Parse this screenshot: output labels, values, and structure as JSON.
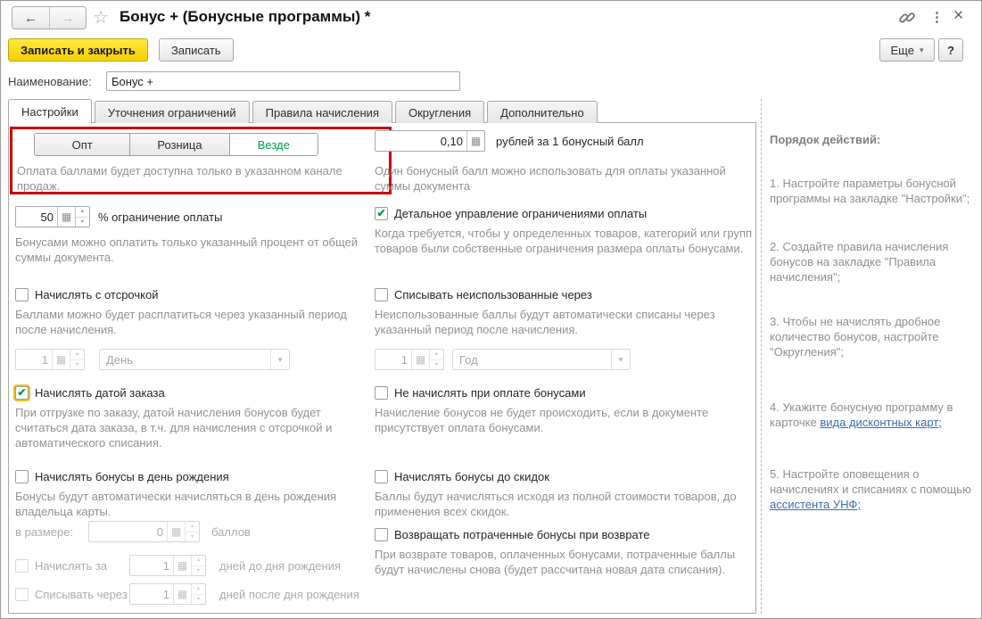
{
  "titlebar": {
    "title": "Бонус + (Бонусные программы) *"
  },
  "toolbar": {
    "save_and_close": "Записать и закрыть",
    "save": "Записать",
    "more": "Еще",
    "help": "?"
  },
  "name_row": {
    "label": "Наименование:",
    "value": "Бонус +"
  },
  "tabs": [
    {
      "label": "Настройки"
    },
    {
      "label": "Уточнения ограничений"
    },
    {
      "label": "Правила начисления"
    },
    {
      "label": "Округления"
    },
    {
      "label": "Дополнительно"
    }
  ],
  "settings": {
    "channel": {
      "opt": "Опт",
      "retail": "Розница",
      "everywhere": "Везде",
      "selected": "Везде",
      "hint": "Оплата баллами будет доступна только в указанном канале продаж."
    },
    "rate": {
      "value": "0,10",
      "label": "рублей за 1 бонусный балл",
      "hint": "Один бонусный балл можно использовать для оплаты указанной суммы документа"
    },
    "limit": {
      "value": "50",
      "label": "% ограничение оплаты",
      "hint": "Бонусами можно оплатить только указанный процент от общей суммы документа."
    },
    "detailed": {
      "label": "Детальное управление ограничениями оплаты",
      "checked": true,
      "hint": "Когда требуется, чтобы у определенных товаров, категорий или групп товаров были собственные ограничения размера оплаты бонусами."
    },
    "deferred": {
      "label": "Начислять с отсрочкой",
      "checked": false,
      "hint": "Баллами можно будет расплатиться через указанный период после начисления.",
      "value": "1",
      "unit": "День"
    },
    "writeoff": {
      "label": "Списывать неиспользованные через",
      "checked": false,
      "hint": "Неиспользованные баллы будут автоматически списаны через указанный период после начисления.",
      "value": "1",
      "unit": "Год"
    },
    "order_date": {
      "label": "Начислять датой заказа",
      "checked": true,
      "hint": "При отгрузке по заказу, датой начисления бонусов будет считаться дата заказа, в т.ч. для начисления с отсрочкой и автоматического списания."
    },
    "no_accrual_on_bonus_pay": {
      "label": "Не начислять при оплате бонусами",
      "checked": false,
      "hint": "Начисление бонусов не будет происходить, если в документе присутствует оплата бонусами."
    },
    "birthday": {
      "label": "Начислять бонусы в день рождения",
      "checked": false,
      "hint": "Бонусы будут автоматически начисляться в день рождения владельца карты.",
      "amount_label": "в размере:",
      "amount_value": "0",
      "amount_unit": "баллов",
      "before_label": "Начислять за",
      "before_value": "1",
      "before_unit": "дней до дня рождения",
      "after_label": "Списывать через",
      "after_value": "1",
      "after_unit": "дней после дня рождения"
    },
    "before_discounts": {
      "label": "Начислять бонусы до скидок",
      "checked": false,
      "hint": "Баллы будут начисляться исходя из полной стоимости товаров, до применения всех скидок."
    },
    "return_bonuses": {
      "label": "Возвращать потраченные бонусы при возврате",
      "checked": false,
      "hint": "При возврате товаров, оплаченных бонусами, потраченные баллы будут начислены снова (будет рассчитана новая дата списания)."
    }
  },
  "sidebar": {
    "title": "Порядок действий:",
    "step1": "1. Настройте параметры бонусной программы на закладке \"Настройки\";",
    "step2": "2. Создайте правила начисления бонусов на закладке \"Правила начисления\";",
    "step3": "3. Чтобы не начислять дробное количество бонусов, настройте \"Округления\";",
    "step4_text": "4. Укажите бонусную программу в карточке ",
    "step4_link": "вида дисконтных карт;",
    "step5_text": "5. Настройте оповещения о начислениях и списаниях с помощью ",
    "step5_link": "ассистента УНФ;"
  },
  "icons": {
    "back": "←",
    "forward": "→",
    "star": "☆",
    "menu": "⋮",
    "close": "×",
    "more_arrow": "▾",
    "dd_arrow": "▾",
    "calc": "▦",
    "spin_up": "▴",
    "spin_down": "▾",
    "check": "✔"
  },
  "colors": {
    "accent_yellow": "#f3cf00",
    "selected_green": "#009e47",
    "annotation_red": "#c80000",
    "link_blue": "#3a6cb5"
  }
}
